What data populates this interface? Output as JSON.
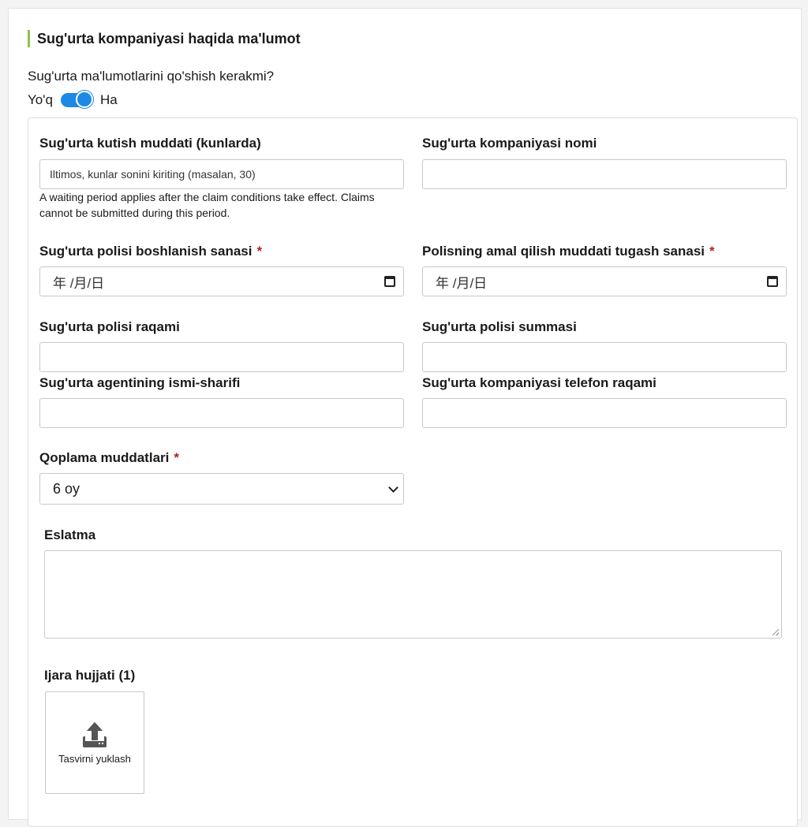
{
  "section": {
    "title": "Sug'urta kompaniyasi haqida ma'lumot"
  },
  "toggle": {
    "question": "Sug'urta ma'lumotlarini qo'shish kerakmi?",
    "off_label": "Yo'q",
    "on_label": "Ha",
    "checked": true
  },
  "fields": {
    "waiting_period": {
      "label": "Sug'urta kutish muddati (kunlarda)",
      "placeholder": "Iltimos, kunlar sonini kiriting (masalan, 30)",
      "help": "A waiting period applies after the claim conditions take effect. Claims cannot be submitted during this period."
    },
    "company_name": {
      "label": "Sug'urta kompaniyasi nomi",
      "value": ""
    },
    "start_date": {
      "label": "Sug'urta polisi boshlanish sanasi",
      "required": "*",
      "display": "年 /月/日"
    },
    "end_date": {
      "label": "Polisning amal qilish muddati tugash sanasi",
      "required": "*",
      "display": "年 /月/日"
    },
    "policy_number": {
      "label": "Sug'urta polisi raqami",
      "value": ""
    },
    "policy_amount": {
      "label": "Sug'urta polisi summasi",
      "value": ""
    },
    "agent_name": {
      "label": "Sug'urta agentining ismi-sharifi",
      "value": ""
    },
    "company_phone": {
      "label": "Sug'urta kompaniyasi telefon raqami",
      "value": ""
    },
    "coverage_terms": {
      "label": "Qoplama muddatlari",
      "required": "*",
      "selected": "6 oy"
    },
    "note": {
      "label": "Eslatma",
      "value": ""
    },
    "lease_doc": {
      "label": "Ijara hujjati (1)",
      "upload_text": "Tasvirni yuklash"
    }
  },
  "colors": {
    "accent": "#1e88e5",
    "section_bar": "#8cc63f",
    "required": "#b22222"
  },
  "icons": {
    "calendar": "calendar-icon",
    "upload": "upload-icon",
    "select": "chevron-down-icon"
  }
}
